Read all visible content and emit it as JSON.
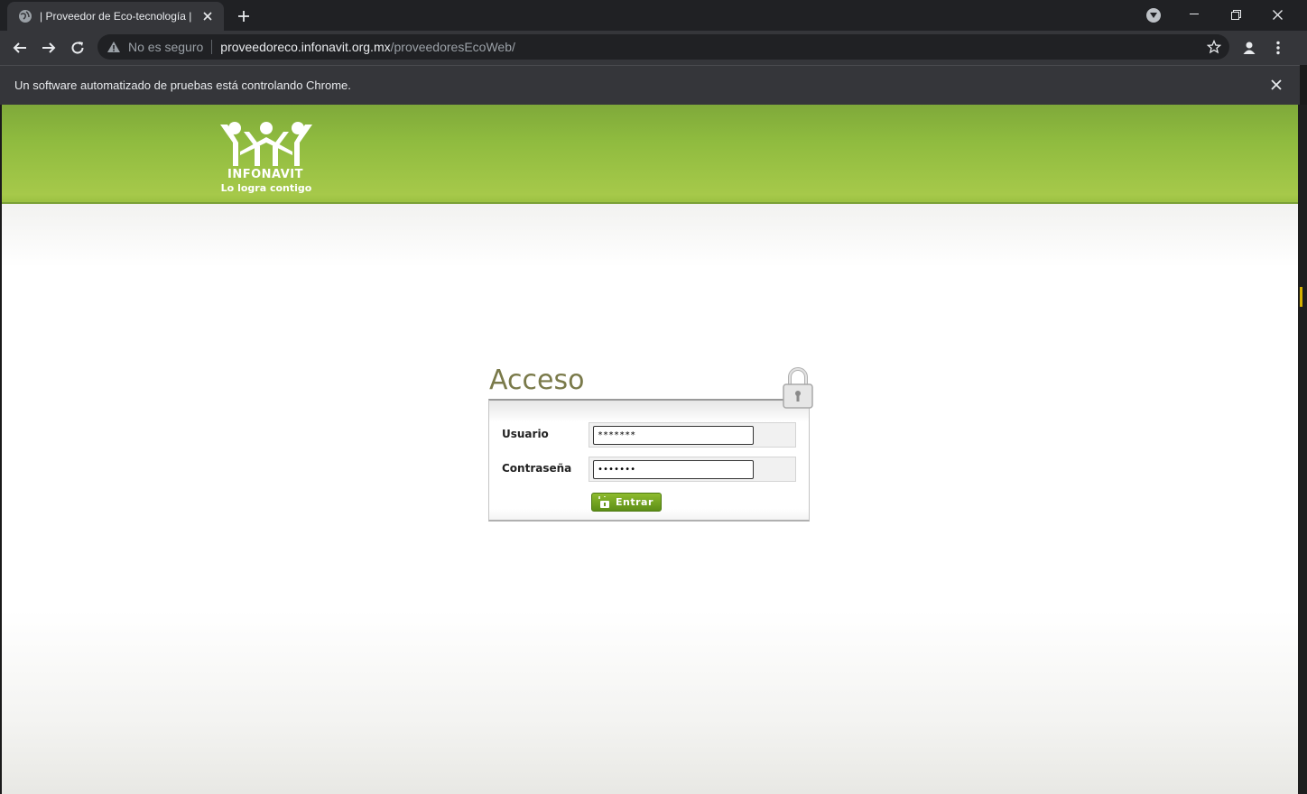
{
  "browser": {
    "tab_title": "| Proveedor de Eco-tecnología |",
    "omnibox": {
      "security_label": "No es seguro",
      "host": "proveedoreco.infonavit.org.mx",
      "path": "/proveedoresEcoWeb/"
    },
    "infobar_text": "Un software automatizado de pruebas está controlando Chrome."
  },
  "header": {
    "logo_name": "INFONAVIT",
    "logo_slogan": "Lo logra contigo",
    "colors": {
      "band": "#8fbb3f"
    }
  },
  "login": {
    "title": "Acceso",
    "username_label": "Usuario",
    "username_value": "*******",
    "password_label": "Contraseña",
    "password_value": "•••••••",
    "submit_label": "Entrar"
  },
  "icons": [
    "globe-icon",
    "close-icon",
    "plus-icon",
    "tab-search-icon",
    "minimize-icon",
    "restore-icon",
    "back-icon",
    "forward-icon",
    "reload-icon",
    "warning-icon",
    "star-icon",
    "profile-icon",
    "menu-icon",
    "lock-icon",
    "unlock-icon"
  ]
}
